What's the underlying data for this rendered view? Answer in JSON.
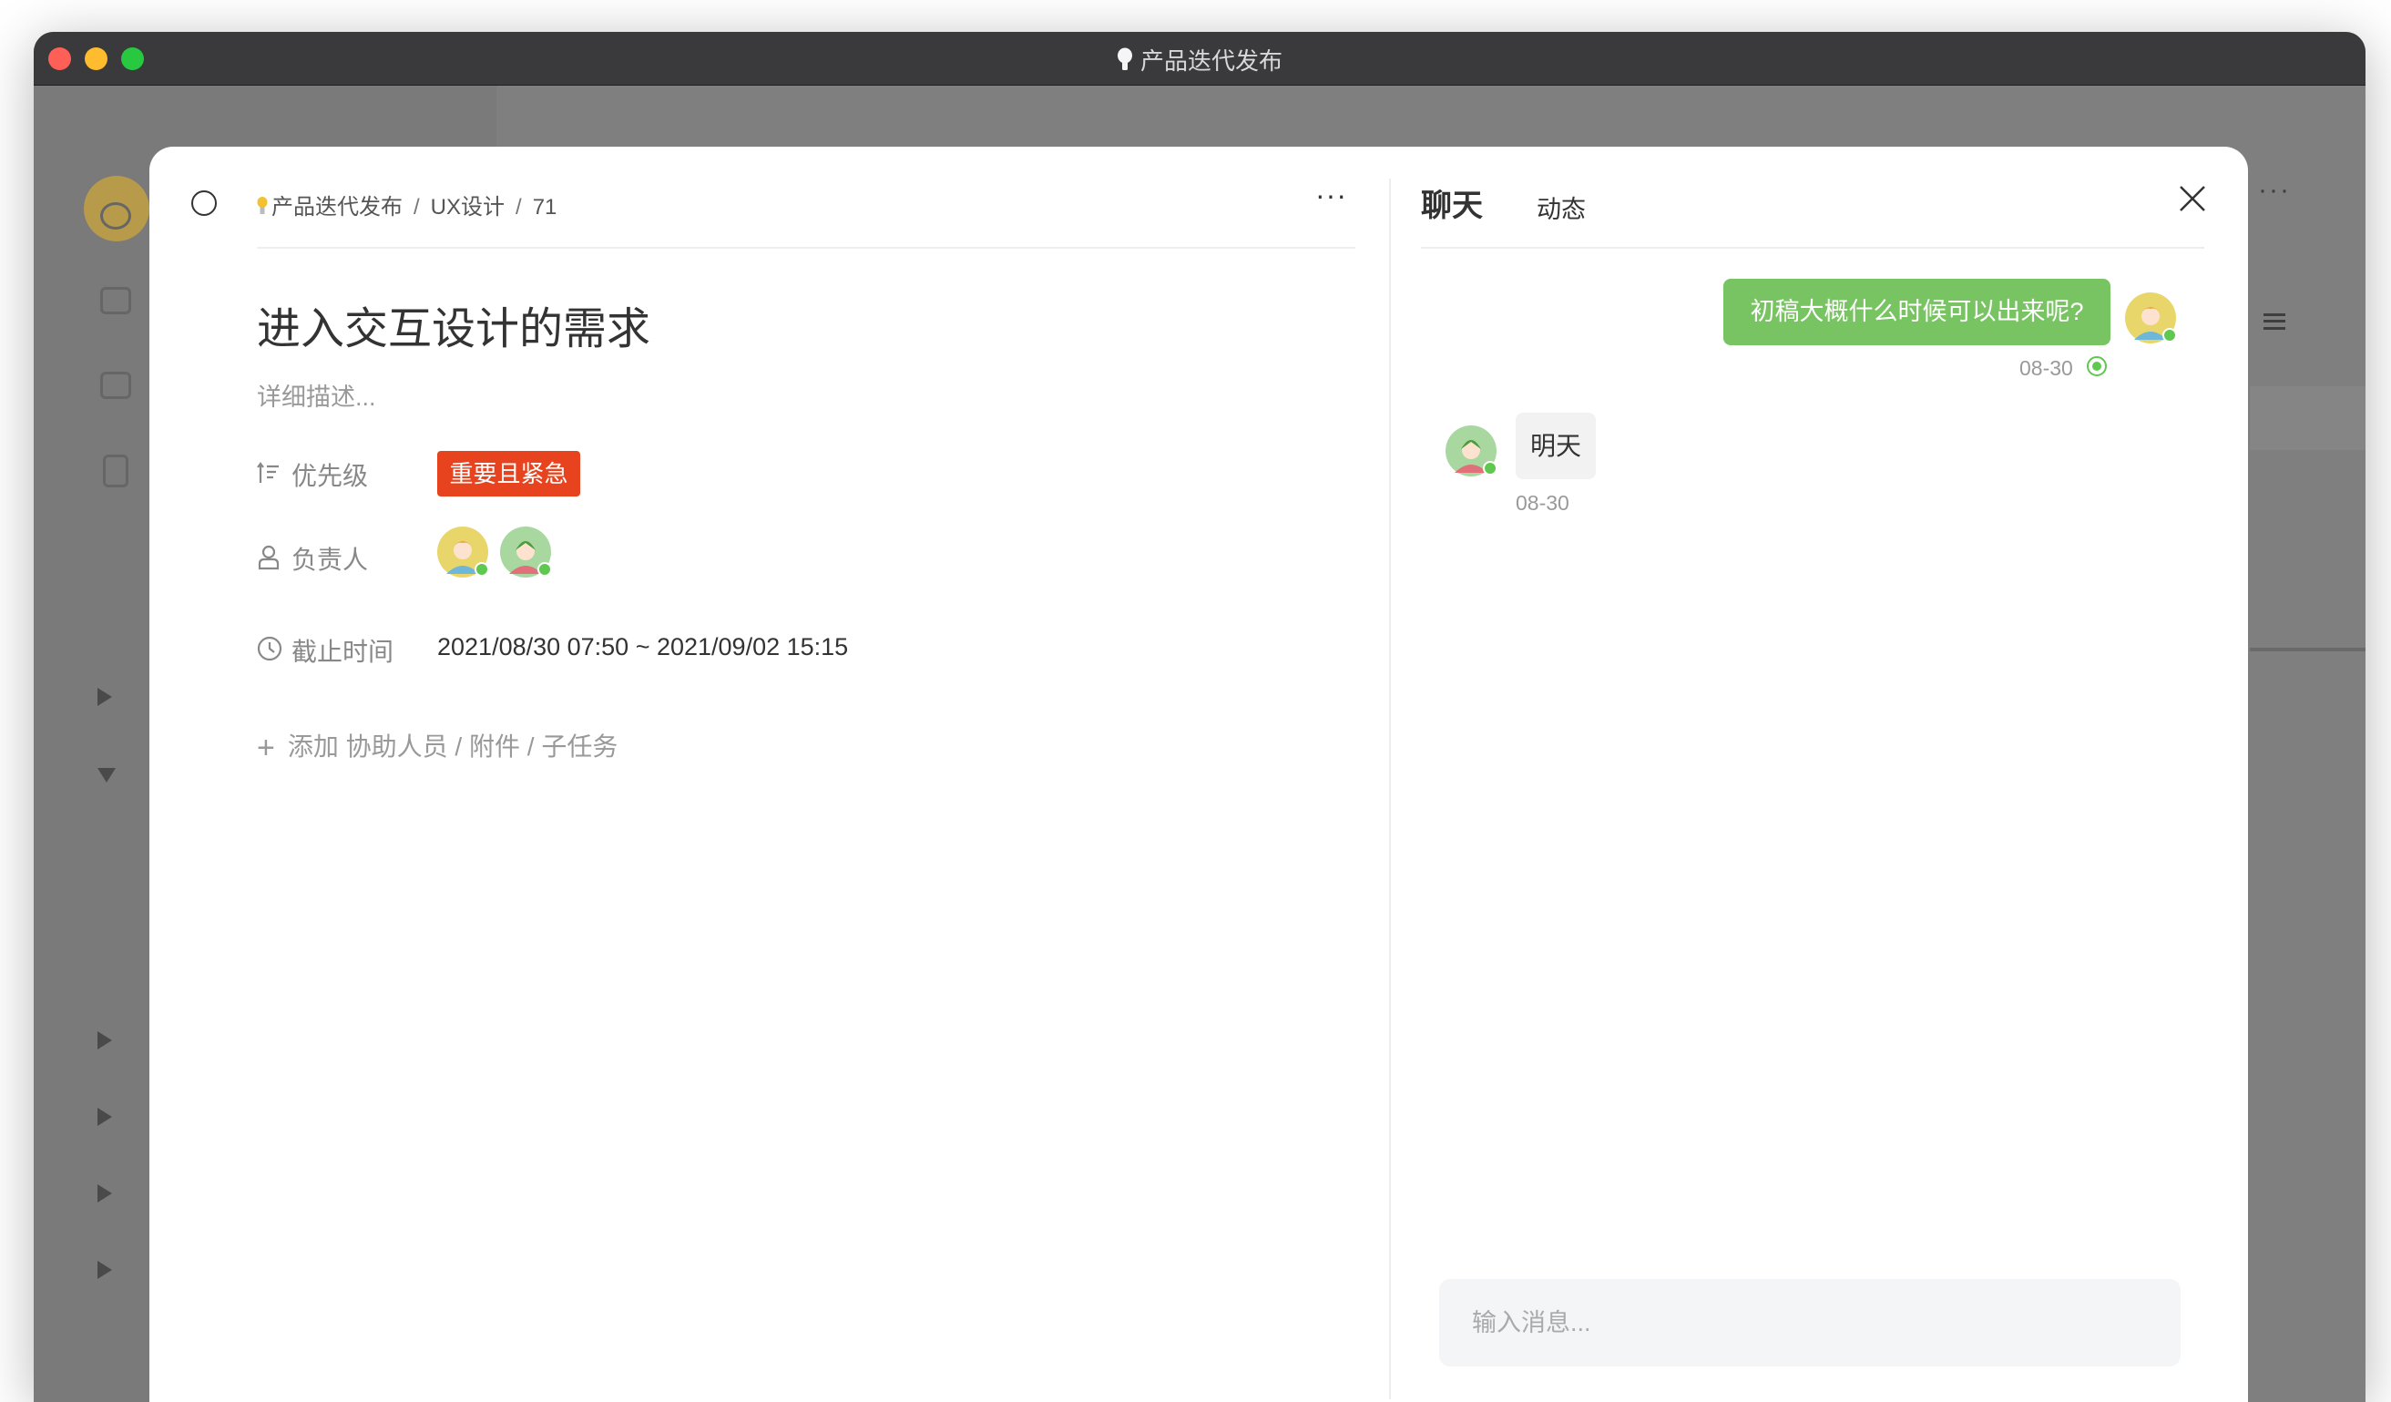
{
  "window": {
    "title": "产品迭代发布"
  },
  "task": {
    "breadcrumb": [
      "产品迭代发布",
      "UX设计",
      "71"
    ],
    "title": "进入交互设计的需求",
    "description_placeholder": "详细描述...",
    "fields": {
      "priority": {
        "label": "优先级",
        "value": "重要且紧急",
        "color": "#e8431f"
      },
      "assignee": {
        "label": "负责人"
      },
      "deadline": {
        "label": "截止时间",
        "value": "2021/08/30 07:50 ~ 2021/09/02 15:15"
      }
    },
    "add_label": "添加 协助人员 / 附件 / 子任务"
  },
  "chat": {
    "tabs": [
      "聊天",
      "动态"
    ],
    "messages": [
      {
        "direction": "out",
        "text": "初稿大概什么时候可以出来呢?",
        "time": "08-30",
        "status": "read"
      },
      {
        "direction": "in",
        "text": "明天",
        "time": "08-30"
      }
    ],
    "input_placeholder": "输入消息..."
  },
  "colors": {
    "accent_green": "#78c462",
    "online": "#5fc84f",
    "urgent": "#e8431f"
  }
}
